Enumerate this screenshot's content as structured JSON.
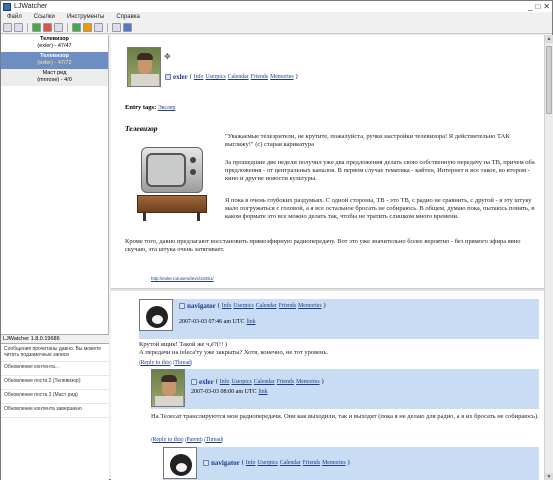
{
  "window": {
    "title": "LJWatcher",
    "controls": [
      "_",
      "□",
      "✕"
    ]
  },
  "menu": [
    "Файл",
    "Ссылки",
    "Инструменты",
    "Справка"
  ],
  "toolbar_icons": [
    "save-icon",
    "folder-icon",
    "add-icon",
    "remove-icon",
    "edit-icon",
    "refresh-icon",
    "stop-icon",
    "options-icon",
    "mail-icon",
    "forward-icon"
  ],
  "feeds": [
    {
      "name": "Телевизор",
      "sub": "(exler) - 47/47",
      "selected": false
    },
    {
      "name": "Телевизор",
      "sub": "(exler) - 47/72",
      "selected": true
    },
    {
      "name": "Маст рид",
      "sub": "(mnrose) - 4/0",
      "selected": false
    }
  ],
  "version": "LJWatcher 1.8.0.19686",
  "log": [
    "Сообщения прочитаны давно. Вы можете читать подзамочные записи",
    "Обновление контента...",
    "Обновление поста 2 (Телевизор)",
    "Обновление поста 3 (Маст рид)",
    "Обновление контента завершено"
  ],
  "post": {
    "username": "exler",
    "user_links": [
      "Info",
      "Userpics",
      "Calendar",
      "Friends",
      "Memories"
    ],
    "entry_tags_label": "Entry tags:",
    "entry_tag": "Экслер",
    "title": "Телевизор",
    "para1": "\"Уважаемые телезрители, не крутите, пожалуйста, ручки настройки телевизора! Я действительно ТАК выгляжу!\" (с) старая карикатура",
    "para2": "За прошедшие две недели получил уже два предложения делать свою собственную передачу на ТВ, причем оба предложения - от центральных каналов. В первом случае тематика - кайтен, Интернет и все такое, во втором - кино и другие новости культуры.",
    "para3": "Я пока в очень глубоких раздумьях. С одной стороны, ТВ - это ТВ, с радио не сравнить, с другой - я эту штуку мало погружаться с головой, а я все остальное бросать не собираюсь. В общем, думаю пока, пытаюсь понять, в каком формате это все можно делать так, чтобы не тратить слишком много времени.",
    "para4": "Кроме того, давно предлагают восстановить прямоэфирную радиопередачу. Вот это уже значительно более вероятно - без прямого эфира явно скучаю, эта штука очень затягивает.",
    "permalink": "http://exler.ru/users/tevs/10361/"
  },
  "comments": [
    {
      "username": "navigator",
      "links": [
        "Info",
        "Userpics",
        "Calendar",
        "Friends",
        "Memories"
      ],
      "date": "2007-03-03 07:46 am UTC",
      "link": "link",
      "text1": "Крутой ящик! Такой же ч,ё?(!! )",
      "text2": "А передачи на teleca'ту уже закрыты? Хотя, конечно, не тот уровень.",
      "reply_labels": [
        "Reply to this",
        "Thread"
      ]
    },
    {
      "username": "exler",
      "links": [
        "Info",
        "Userpics",
        "Calendar",
        "Friends",
        "Memories"
      ],
      "date": "2007-03-03 08:00 am UTC",
      "link": "link",
      "text1": "На Телесат транслируются мои радиопередачи. Они как выходили, так и выходят (пока я не делаю для радио, а я их бросать не собираюсь).",
      "reply_labels": [
        "Reply to this",
        "Parent",
        "Thread"
      ]
    },
    {
      "username": "navigator",
      "links": [
        "Info",
        "Userpics",
        "Calendar",
        "Friends",
        "Memories"
      ]
    }
  ]
}
